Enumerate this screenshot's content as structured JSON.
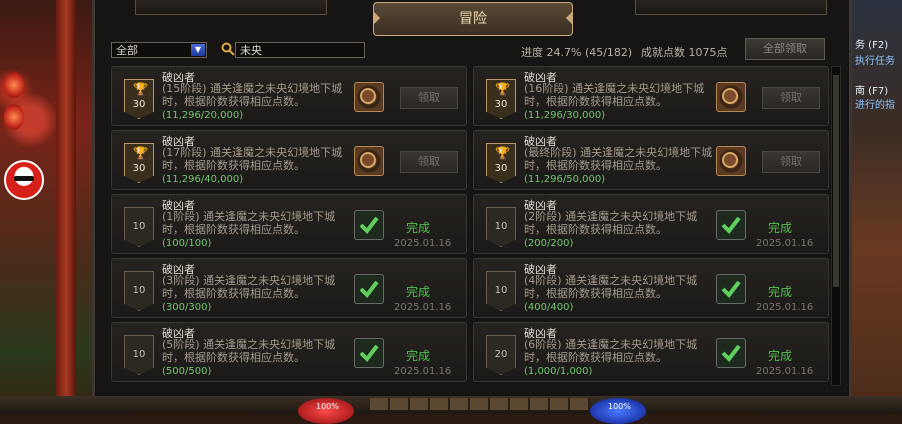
{
  "side": {
    "line1": "务 (F2)",
    "line2": "执行任务",
    "line3": "南 (F7)",
    "line4": "进行的指"
  },
  "tabs": {
    "left": "",
    "active": "冒险",
    "right": ""
  },
  "toolbar": {
    "filter_value": "全部",
    "search_value": "未央",
    "progress_label": "进度",
    "progress_value": "24.7% (45/182)",
    "progress_fraction": 0.247,
    "points_label": "成就点数",
    "points_value": "1075点",
    "claim_all": "全部领取"
  },
  "achievements": [
    {
      "title": "破凶者",
      "desc": "(15阶段) 通关逢魔之未央幻境地下城时，根据阶数获得相应点数。",
      "count": "(11,296/20,000)",
      "badge": "30",
      "status": "claim",
      "action": "领取",
      "date": ""
    },
    {
      "title": "破凶者",
      "desc": "(16阶段) 通关逢魔之未央幻境地下城时，根据阶数获得相应点数。",
      "count": "(11,296/30,000)",
      "badge": "30",
      "status": "claim",
      "action": "领取",
      "date": ""
    },
    {
      "title": "破凶者",
      "desc": "(17阶段) 通关逢魔之未央幻境地下城时，根据阶数获得相应点数。",
      "count": "(11,296/40,000)",
      "badge": "30",
      "status": "claim",
      "action": "领取",
      "date": ""
    },
    {
      "title": "破凶者",
      "desc": "(最终阶段) 通关逢魔之未央幻境地下城时，根据阶数获得相应点数。",
      "count": "(11,296/50,000)",
      "badge": "30",
      "status": "claim",
      "action": "领取",
      "date": ""
    },
    {
      "title": "破凶者",
      "desc": "(1阶段) 通关逢魔之未央幻境地下城时，根据阶数获得相应点数。",
      "count": "(100/100)",
      "badge": "10",
      "status": "done",
      "action": "完成",
      "date": "2025.01.16"
    },
    {
      "title": "破凶者",
      "desc": "(2阶段) 通关逢魔之未央幻境地下城时，根据阶数获得相应点数。",
      "count": "(200/200)",
      "badge": "10",
      "status": "done",
      "action": "完成",
      "date": "2025.01.16"
    },
    {
      "title": "破凶者",
      "desc": "(3阶段) 通关逢魔之未央幻境地下城时，根据阶数获得相应点数。",
      "count": "(300/300)",
      "badge": "10",
      "status": "done",
      "action": "完成",
      "date": "2025.01.16"
    },
    {
      "title": "破凶者",
      "desc": "(4阶段) 通关逢魔之未央幻境地下城时，根据阶数获得相应点数。",
      "count": "(400/400)",
      "badge": "10",
      "status": "done",
      "action": "完成",
      "date": "2025.01.16"
    },
    {
      "title": "破凶者",
      "desc": "(5阶段) 通关逢魔之未央幻境地下城时，根据阶数获得相应点数。",
      "count": "(500/500)",
      "badge": "10",
      "status": "done",
      "action": "完成",
      "date": "2025.01.16"
    },
    {
      "title": "破凶者",
      "desc": "(6阶段) 通关逢魔之未央幻境地下城时，根据阶数获得相应点数。",
      "count": "(1,000/1,000)",
      "badge": "20",
      "status": "done",
      "action": "完成",
      "date": "2025.01.16"
    }
  ],
  "hud": {
    "hp_pct": "100%",
    "mp_pct": "100%"
  },
  "colors": {
    "done_green": "#4fc24f",
    "count_green": "#6ec86e",
    "tab_gold": "#c8a878"
  }
}
